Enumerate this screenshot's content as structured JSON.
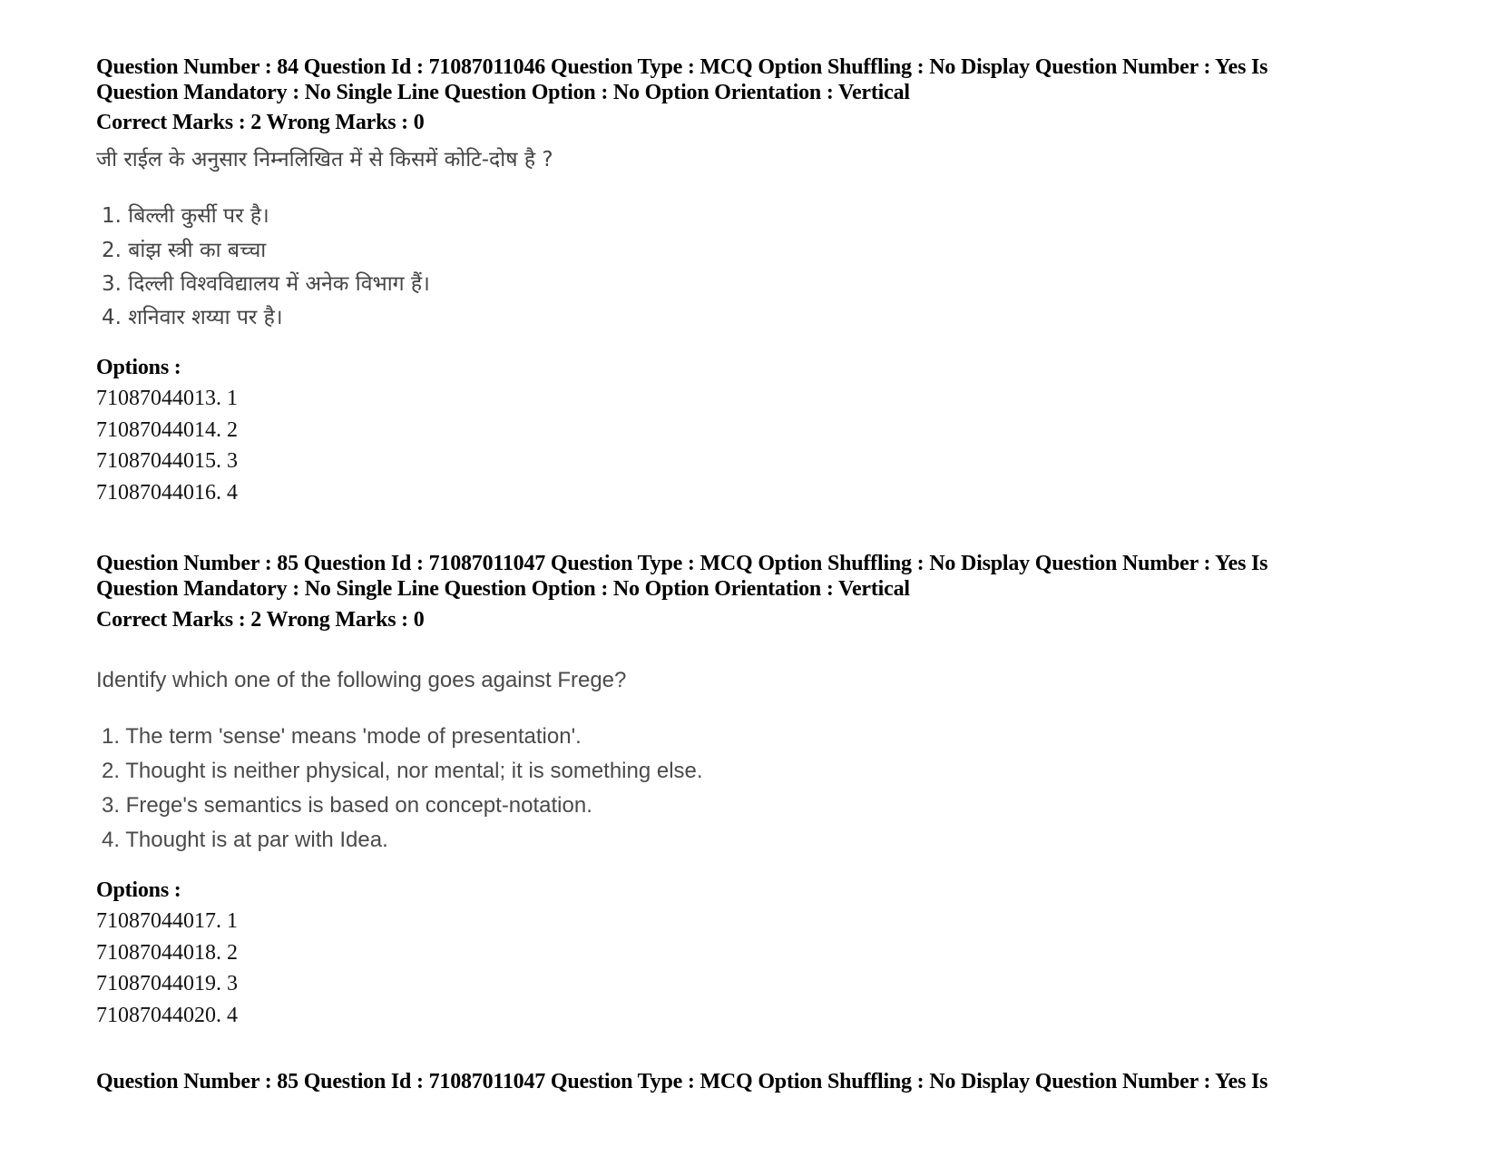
{
  "questions": [
    {
      "header_line1": "Question Number : 84 Question Id : 71087011046 Question Type : MCQ Option Shuffling : No Display Question Number : Yes Is",
      "header_line2": "Question Mandatory : No Single Line Question Option : No Option Orientation : Vertical",
      "marks": "Correct Marks : 2 Wrong Marks : 0",
      "question_text": "जी राईल के अनुसार निम्नलिखित में से किसमें कोटि-दोष है ?",
      "items": [
        "1. बिल्ली कुर्सी पर है।",
        "2. बांझ स्त्री का बच्चा",
        "3. दिल्ली विश्वविद्यालय में अनेक विभाग हैं।",
        "4. शनिवार शय्या पर है।"
      ],
      "options_label": "Options :",
      "options": [
        "71087044013. 1",
        "71087044014. 2",
        "71087044015. 3",
        "71087044016. 4"
      ]
    },
    {
      "header_line1": "Question Number : 85 Question Id : 71087011047 Question Type : MCQ Option Shuffling : No Display Question Number : Yes Is",
      "header_line2": "Question Mandatory : No Single Line Question Option : No Option Orientation : Vertical",
      "marks": "Correct Marks : 2 Wrong Marks : 0",
      "question_text": "Identify which one of the following goes against Frege?",
      "items": [
        "1. The term 'sense' means 'mode of presentation'.",
        "2. Thought is neither physical, nor mental; it is something else.",
        "3. Frege's semantics is based on concept-notation.",
        "4. Thought is at par with Idea."
      ],
      "options_label": "Options :",
      "options": [
        "71087044017. 1",
        "71087044018. 2",
        "71087044019. 3",
        "71087044020. 4"
      ]
    }
  ],
  "trailing_header": "Question Number : 85 Question Id : 71087011047 Question Type : MCQ Option Shuffling : No Display Question Number : Yes Is"
}
